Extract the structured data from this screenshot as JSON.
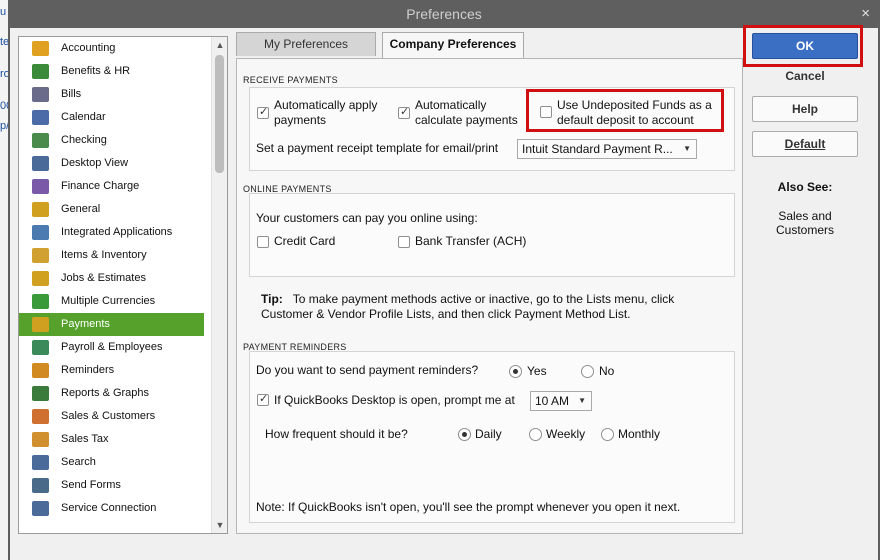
{
  "window": {
    "title": "Preferences",
    "close_label": "×"
  },
  "left_edge_glyphs": [
    "u",
    "te",
    "ro",
    "00",
    "p/"
  ],
  "sidebar": {
    "items": [
      {
        "label": "Accounting",
        "icon": "accounting-icon",
        "color": "#e0a020"
      },
      {
        "label": "Benefits & HR",
        "icon": "people-icon",
        "color": "#3a8a3a"
      },
      {
        "label": "Bills",
        "icon": "bills-icon",
        "color": "#6a6a8a"
      },
      {
        "label": "Calendar",
        "icon": "calendar-icon",
        "color": "#4a6aa8"
      },
      {
        "label": "Checking",
        "icon": "checking-icon",
        "color": "#4a8a4a"
      },
      {
        "label": "Desktop View",
        "icon": "desktop-icon",
        "color": "#4a6a9a"
      },
      {
        "label": "Finance Charge",
        "icon": "percent-icon",
        "color": "#7a5aa8"
      },
      {
        "label": "General",
        "icon": "general-icon",
        "color": "#d0a020"
      },
      {
        "label": "Integrated Applications",
        "icon": "integrated-apps-icon",
        "color": "#4a7ab0"
      },
      {
        "label": "Items & Inventory",
        "icon": "inventory-icon",
        "color": "#d0a030"
      },
      {
        "label": "Jobs & Estimates",
        "icon": "jobs-icon",
        "color": "#d0a020"
      },
      {
        "label": "Multiple Currencies",
        "icon": "currencies-icon",
        "color": "#3a9a3a"
      },
      {
        "label": "Payments",
        "icon": "payments-icon",
        "color": "#d0a020",
        "selected": true
      },
      {
        "label": "Payroll & Employees",
        "icon": "payroll-icon",
        "color": "#3a8a5a"
      },
      {
        "label": "Reminders",
        "icon": "clock-icon",
        "color": "#d08a20"
      },
      {
        "label": "Reports & Graphs",
        "icon": "graph-icon",
        "color": "#3a7a3a"
      },
      {
        "label": "Sales & Customers",
        "icon": "sales-icon",
        "color": "#d07030"
      },
      {
        "label": "Sales Tax",
        "icon": "sales-tax-icon",
        "color": "#d09030"
      },
      {
        "label": "Search",
        "icon": "search-icon",
        "color": "#4a6a9a"
      },
      {
        "label": "Send Forms",
        "icon": "send-forms-icon",
        "color": "#4a6a8a"
      },
      {
        "label": "Service Connection",
        "icon": "service-connection-icon",
        "color": "#4a6a9a"
      }
    ],
    "scroll_up": "▲",
    "scroll_down": "▼"
  },
  "tabs": {
    "my": "My Preferences",
    "company": "Company Preferences"
  },
  "receive_payments": {
    "title": "RECEIVE PAYMENTS",
    "auto_apply_line1": "Automatically apply",
    "auto_apply_line2": "payments",
    "auto_apply_checked": true,
    "auto_calc_line1": "Automatically",
    "auto_calc_line2": "calculate payments",
    "auto_calc_checked": true,
    "undeposited_line1": "Use Undeposited Funds as a",
    "undeposited_line2": "default deposit to account",
    "undeposited_checked": false,
    "template_label": "Set a payment receipt template for email/print",
    "template_value": "Intuit Standard Payment R..."
  },
  "online_payments": {
    "title": "ONLINE PAYMENTS",
    "intro": "Your customers can pay you online using:",
    "credit_card": "Credit Card",
    "bank_transfer": "Bank Transfer (ACH)"
  },
  "tip": {
    "label": "Tip:",
    "line1": "To make payment methods active or inactive, go to the Lists menu, click",
    "line2": "Customer & Vendor Profile Lists, and then click Payment Method List."
  },
  "payment_reminders": {
    "title": "PAYMENT REMINDERS",
    "question": "Do you want to send payment reminders?",
    "yes": "Yes",
    "no": "No",
    "prompt_label": "If QuickBooks Desktop is open, prompt me at",
    "prompt_checked": true,
    "time_value": "10 AM",
    "frequency_label": "How frequent should it be?",
    "daily": "Daily",
    "weekly": "Weekly",
    "monthly": "Monthly",
    "note": "Note: If QuickBooks isn't open, you'll see the prompt whenever you open it next."
  },
  "buttons": {
    "ok": "OK",
    "cancel": "Cancel",
    "help": "Help",
    "default": "Default"
  },
  "also_see": {
    "title": "Also See:",
    "link_line1": "Sales and",
    "link_line2": "Customers"
  },
  "colors": {
    "selected": "#55a12b",
    "ok": "#3a6fc4",
    "highlight": "#d01010"
  }
}
